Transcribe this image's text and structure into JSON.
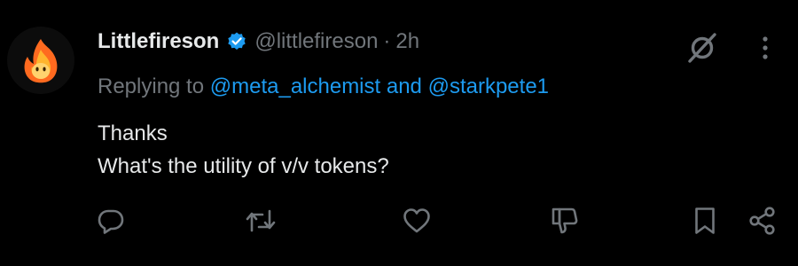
{
  "post": {
    "display_name": "Littlefireson",
    "handle": "@littlefireson",
    "separator": "·",
    "time": "2h",
    "replying_prefix": "Replying to",
    "mention_1": "@meta_alchemist",
    "mention_joiner": "and",
    "mention_2": "@starkpete1",
    "body_lines": [
      "Thanks",
      "What's the utility of v/v tokens?"
    ]
  },
  "icons": {
    "avatar": "fire-emoji-avatar",
    "verified": "verified-badge-icon",
    "grok": "grok-icon",
    "more": "more-options-icon",
    "reply": "reply-icon",
    "repost": "repost-icon",
    "like": "like-icon",
    "dislike": "downvote-icon",
    "bookmark": "bookmark-icon",
    "share": "share-icon"
  },
  "colors": {
    "background": "#000000",
    "text_primary": "#e7e9ea",
    "text_secondary": "#71767b",
    "accent": "#1d9bf0"
  }
}
